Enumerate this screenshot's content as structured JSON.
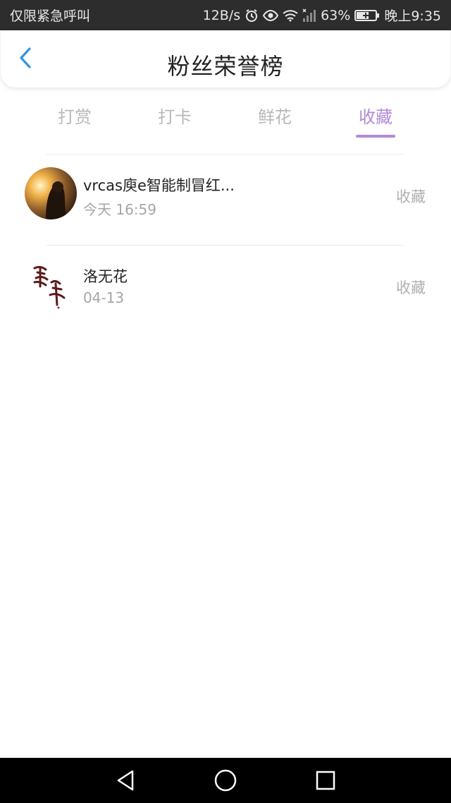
{
  "status_bar": {
    "left_text": "仅限紧急呼叫",
    "speed": "12B/s",
    "battery": "63%",
    "time": "晚上9:35"
  },
  "header": {
    "title": "粉丝荣誉榜",
    "back_icon": "chevron-left-icon"
  },
  "tabs": [
    {
      "label": "打赏",
      "active": false
    },
    {
      "label": "打卡",
      "active": false
    },
    {
      "label": "鲜花",
      "active": false
    },
    {
      "label": "收藏",
      "active": true
    }
  ],
  "colors": {
    "accent": "#b28ad6",
    "back": "#2f95e0"
  },
  "list": [
    {
      "name": "vrcas庾e智能制冒红...",
      "time": "今天 16:59",
      "action": "收藏"
    },
    {
      "name": "洛无花",
      "time": "04-13",
      "action": "收藏"
    }
  ],
  "nav_bar": {
    "icons": [
      "back-triangle-icon",
      "home-circle-icon",
      "recents-square-icon"
    ]
  }
}
